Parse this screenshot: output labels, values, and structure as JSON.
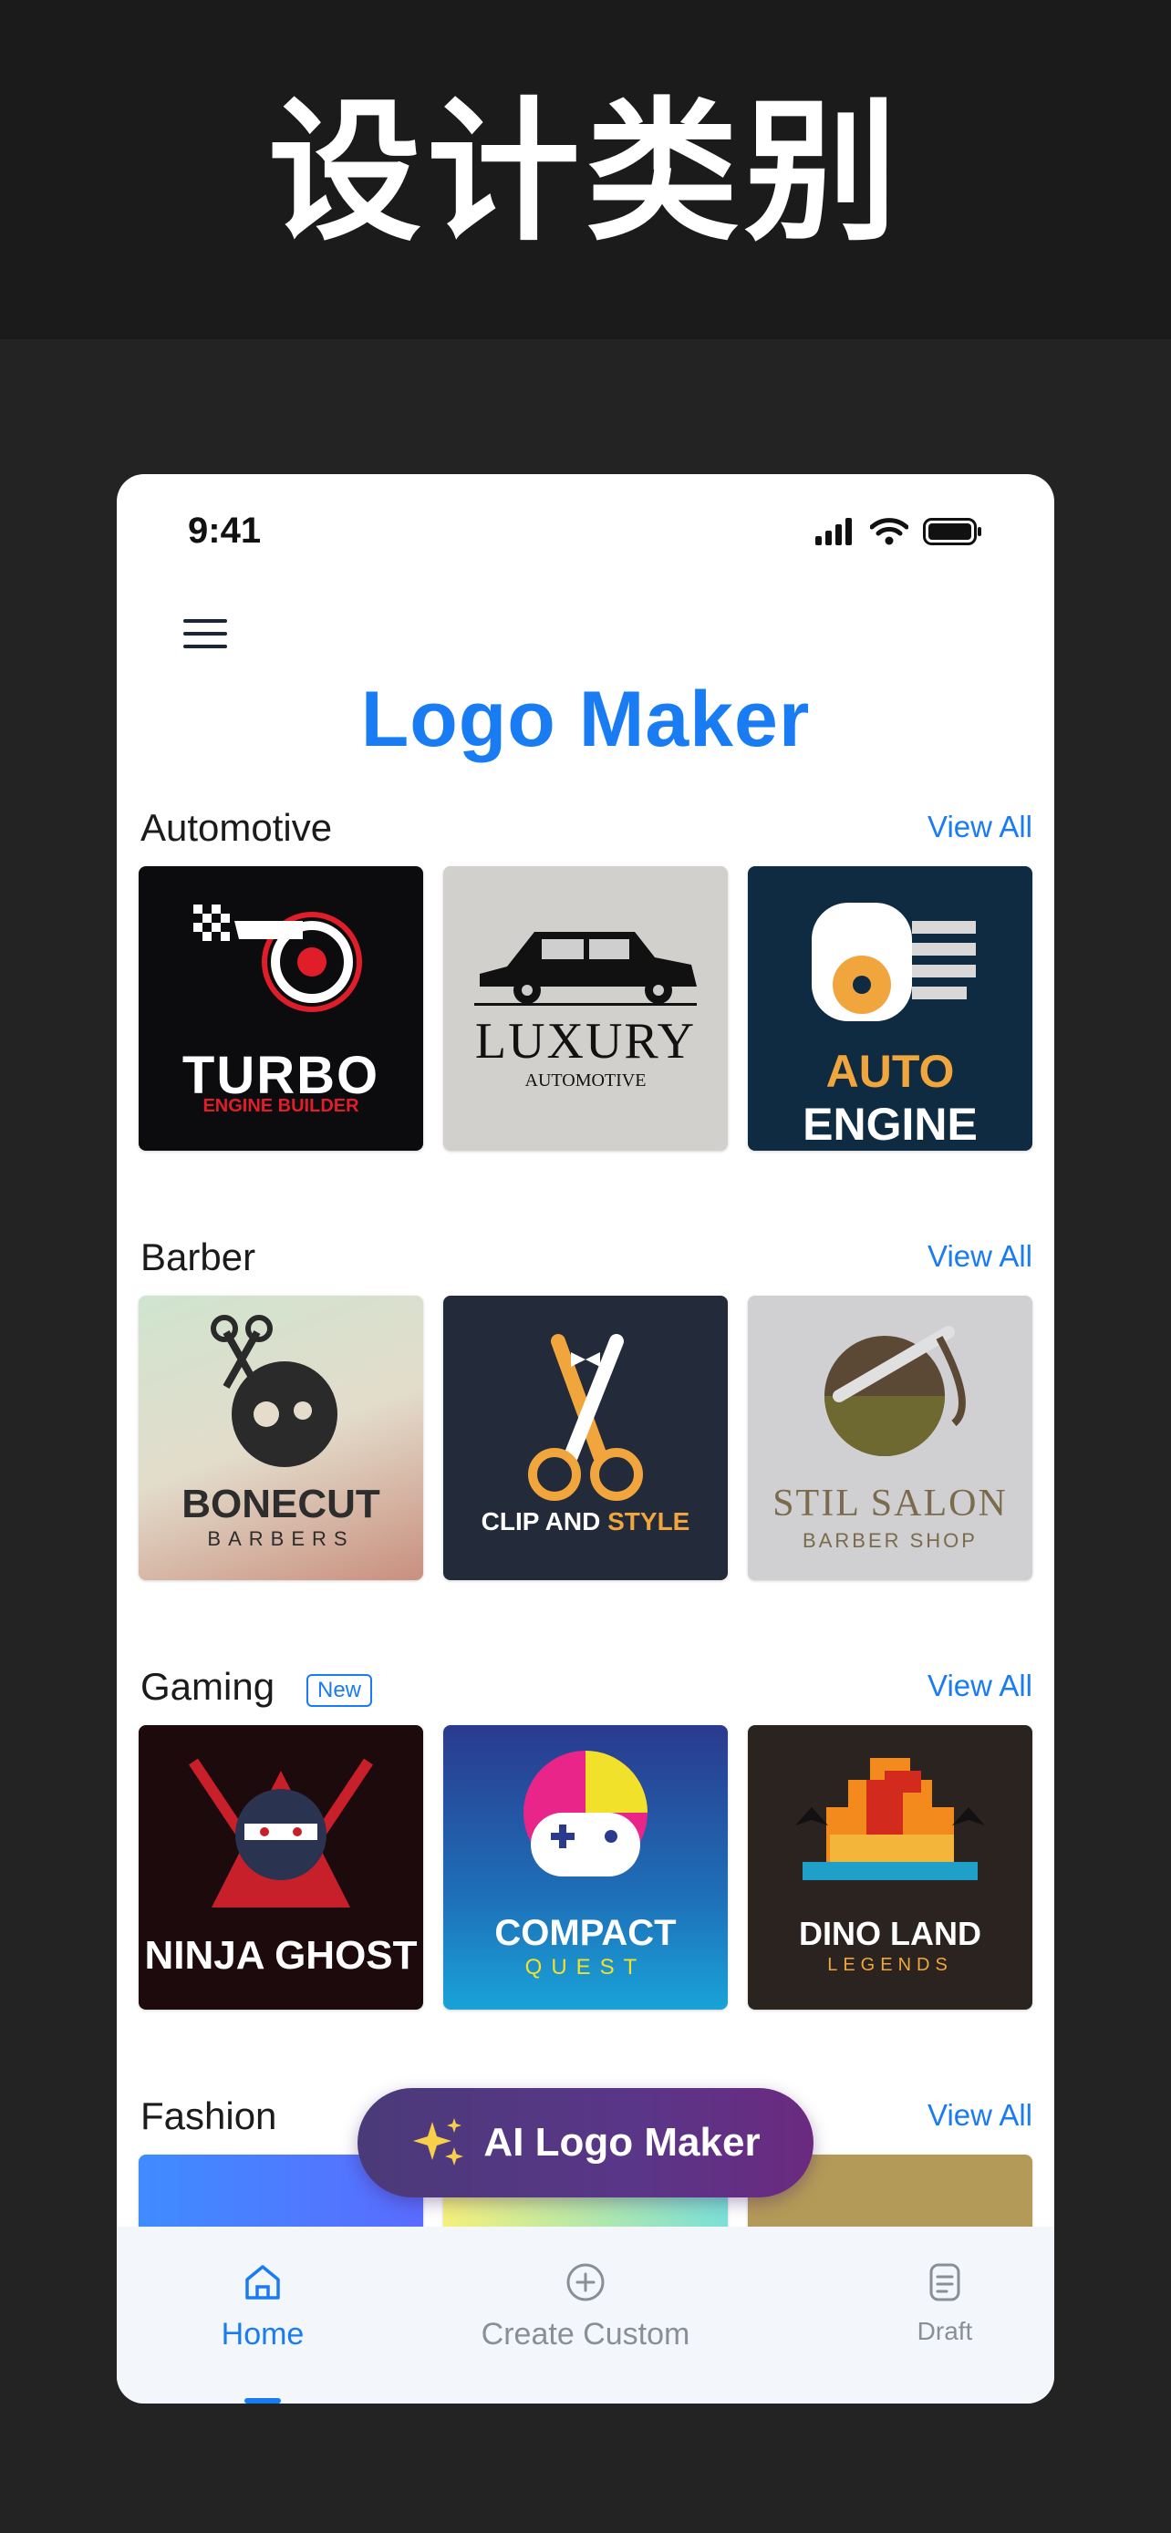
{
  "banner": {
    "title": "设计类别"
  },
  "status": {
    "time": "9:41"
  },
  "app": {
    "title": "Logo Maker"
  },
  "sections": [
    {
      "title": "Automotive",
      "view_all": "View All",
      "cards": [
        {
          "name": "TURBO",
          "sub": "ENGINE BUILDER"
        },
        {
          "name": "LUXURY",
          "sub": "AUTOMOTIVE"
        },
        {
          "name1": "AUTO",
          "name2": "ENGINE"
        }
      ]
    },
    {
      "title": "Barber",
      "view_all": "View All",
      "cards": [
        {
          "name": "BONECUT",
          "sub": "BARBERS"
        },
        {
          "name1": "CLIP AND",
          "name2": "STYLE"
        },
        {
          "name": "STIL SALON",
          "sub": "BARBER SHOP"
        }
      ]
    },
    {
      "title": "Gaming",
      "badge": "New",
      "view_all": "View All",
      "cards": [
        {
          "name": "NINJA GHOST"
        },
        {
          "name": "COMPACT",
          "sub": "QUEST"
        },
        {
          "name": "DINO LAND",
          "sub": "LEGENDS"
        }
      ]
    },
    {
      "title": "Fashion",
      "view_all": "View All"
    }
  ],
  "fab": {
    "label": "AI Logo Maker",
    "icon": "sparkles-icon"
  },
  "tabs": [
    {
      "label": "Home",
      "icon": "home-icon",
      "active": true
    },
    {
      "label": "Create Custom",
      "icon": "plus-circle-icon",
      "active": false
    },
    {
      "label": "Draft",
      "icon": "document-icon",
      "active": false
    }
  ],
  "colors": {
    "accent": "#1a7cf2",
    "text": "#1b1b1b",
    "inactive": "#8a8f96"
  }
}
